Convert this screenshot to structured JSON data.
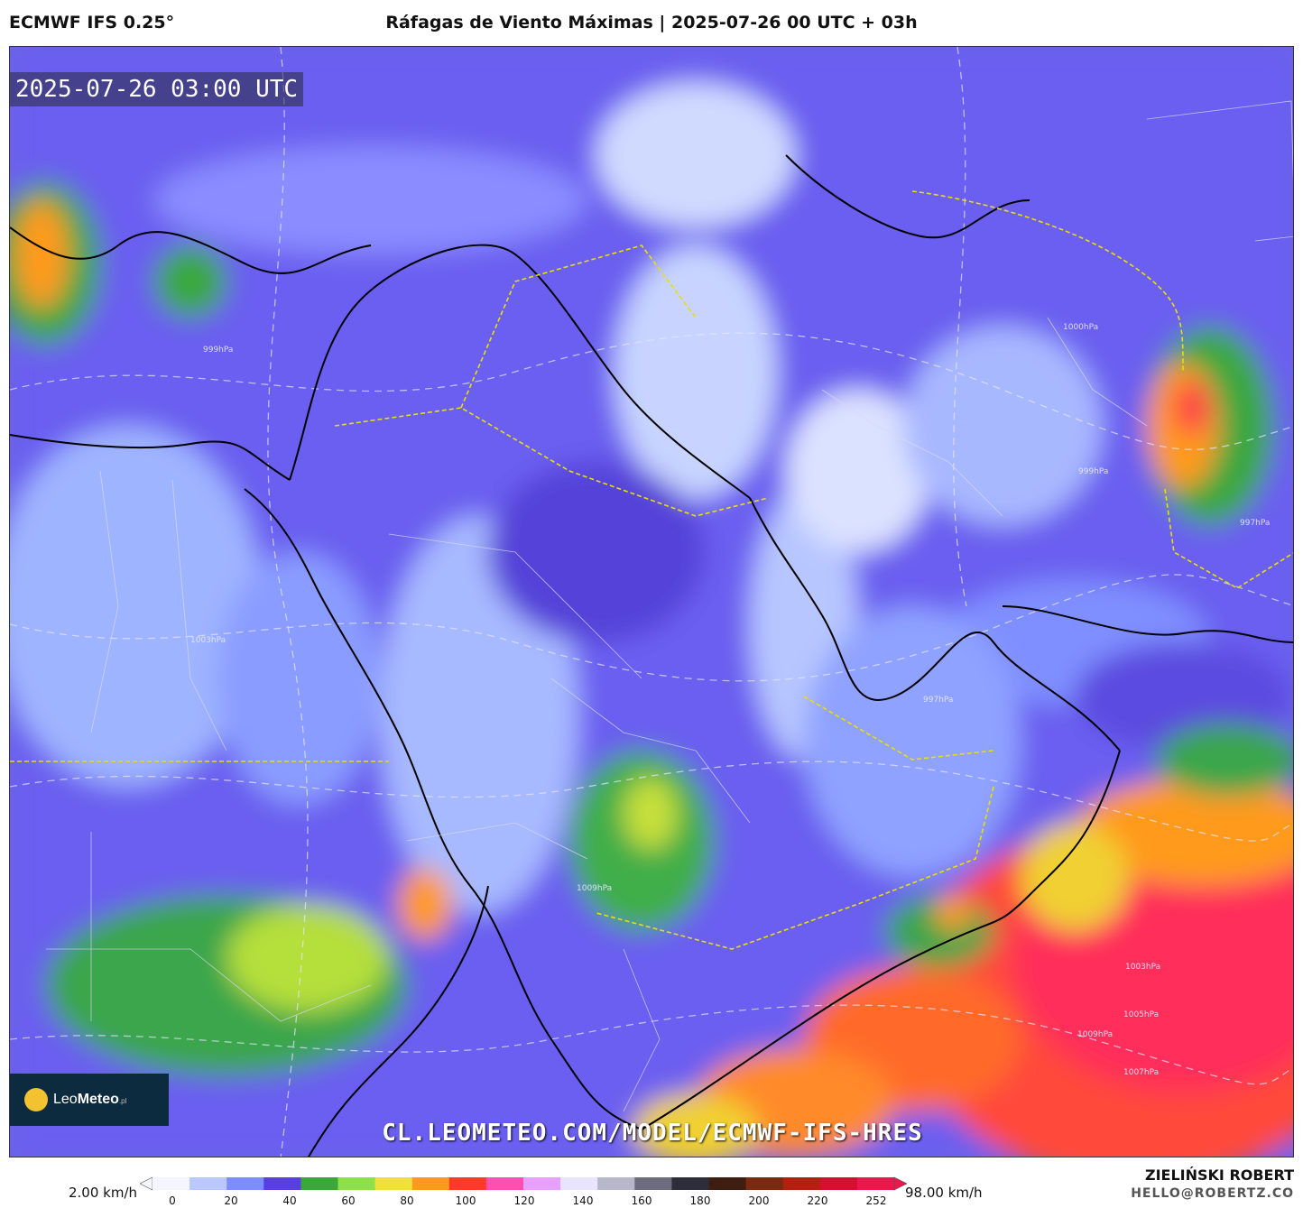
{
  "header": {
    "model": "ECMWF IFS 0.25°",
    "title": "Ráfagas de Viento Máximas | 2025-07-26 00 UTC + 03h"
  },
  "map": {
    "valid_time": "2025-07-26 03:00 UTC",
    "url": "CL.LEOMETEO.COM/MODEL/ECMWF-IFS-HRES",
    "logo": {
      "name": "Leo",
      "bold": "Meteo",
      "suffix": ".pl"
    },
    "isobar_labels": [
      "999hPa",
      "1003hPa",
      "1009hPa",
      "1009hPa",
      "997hPa",
      "1000hPa",
      "999hPa",
      "997hPa",
      "1005hPa",
      "1007hPa",
      "1003hPa"
    ]
  },
  "legend": {
    "min_label": "2.00 km/h",
    "max_label": "98.00 km/h",
    "ticks": [
      "0",
      "20",
      "40",
      "60",
      "80",
      "100",
      "120",
      "140",
      "160",
      "180",
      "200",
      "220",
      "252"
    ],
    "colors": [
      "#f4f6ff",
      "#b9c8ff",
      "#7d8cff",
      "#5a3fe0",
      "#3aa83a",
      "#8ee04a",
      "#f0e03c",
      "#ff9a1e",
      "#ff3a2a",
      "#ff4fb0",
      "#e7a0ff",
      "#e9e4ff",
      "#b7b7c9",
      "#6d6d80",
      "#2e2e3a",
      "#3e1e10",
      "#7a2a10",
      "#b42010",
      "#d40f30",
      "#e8184d"
    ]
  },
  "credits": {
    "author": "ZIELIŃSKI ROBERT",
    "email": "HELLO@ROBERTZ.CO"
  }
}
